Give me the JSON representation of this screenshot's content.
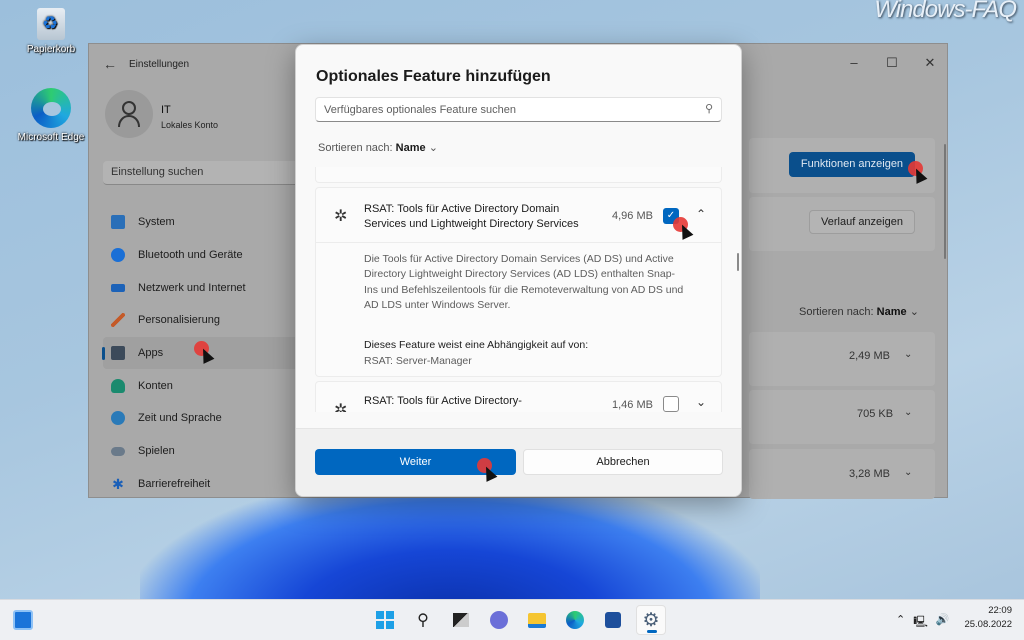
{
  "desktop": {
    "watermark": "Windows-FAQ",
    "icons": [
      {
        "label": "Papierkorb",
        "icon": "recycle-bin-icon"
      },
      {
        "label": "Microsoft Edge",
        "icon": "edge-icon"
      }
    ]
  },
  "settings_window": {
    "title": "Einstellungen",
    "user": {
      "name": "IT",
      "account_type": "Lokales Konto"
    },
    "search_placeholder": "Einstellung suchen",
    "nav": [
      {
        "label": "System",
        "icon": "system-icon",
        "color": "#2a6fb8"
      },
      {
        "label": "Bluetooth und Geräte",
        "icon": "bluetooth-icon",
        "color": "#1a6fd6"
      },
      {
        "label": "Netzwerk und Internet",
        "icon": "wifi-icon",
        "color": "#1c62b8"
      },
      {
        "label": "Personalisierung",
        "icon": "brush-icon",
        "color": "#c45a28"
      },
      {
        "label": "Apps",
        "icon": "apps-icon",
        "color": "#3c4a5a",
        "active": true
      },
      {
        "label": "Konten",
        "icon": "account-icon",
        "color": "#1a8a6e"
      },
      {
        "label": "Zeit und Sprache",
        "icon": "clock-globe-icon",
        "color": "#2a7ab8"
      },
      {
        "label": "Spielen",
        "icon": "gamepad-icon",
        "color": "#6a7a8a"
      },
      {
        "label": "Barrierefreiheit",
        "icon": "accessibility-icon",
        "color": "#1a5fb8"
      }
    ],
    "buttons": {
      "view_features": "Funktionen anzeigen",
      "view_history": "Verlauf anzeigen"
    },
    "sort": {
      "label": "Sortieren nach:",
      "value": "Name"
    },
    "installed_sizes": [
      "2,49 MB",
      "705 KB",
      "3,28 MB"
    ]
  },
  "dialog": {
    "title": "Optionales Feature hinzufügen",
    "search_placeholder": "Verfügbares optionales Feature suchen",
    "sort": {
      "label": "Sortieren nach:",
      "value": "Name"
    },
    "features": [
      {
        "name": "RSAT: Tools für Active Directory Domain Services und Lightweight Directory Services",
        "size": "4,96 MB",
        "checked": true,
        "expanded": true,
        "description": "Die Tools für Active Directory Domain Services (AD DS) und Active Directory Lightweight Directory Services (AD LDS) enthalten Snap-Ins und Befehlszeilentools für die Remoteverwaltung von AD DS und AD LDS unter Windows Server.",
        "dependency_label": "Dieses Feature weist eine Abhängigkeit auf von:",
        "dependency": "RSAT: Server-Manager"
      },
      {
        "name": "RSAT: Tools für Active Directory-",
        "size": "1,46 MB",
        "checked": false,
        "expanded": false
      }
    ],
    "buttons": {
      "next": "Weiter",
      "cancel": "Abbrechen"
    }
  },
  "taskbar": {
    "apps": [
      "start-icon",
      "search-icon",
      "task-view-icon",
      "teams-chat-icon",
      "file-explorer-icon",
      "edge-icon",
      "store-icon",
      "settings-gear-icon"
    ],
    "active_app": "settings-gear-icon",
    "time": "22:09",
    "date": "25.08.2022"
  },
  "colors": {
    "accent": "#0067c0",
    "click_marker": "#e53935"
  }
}
